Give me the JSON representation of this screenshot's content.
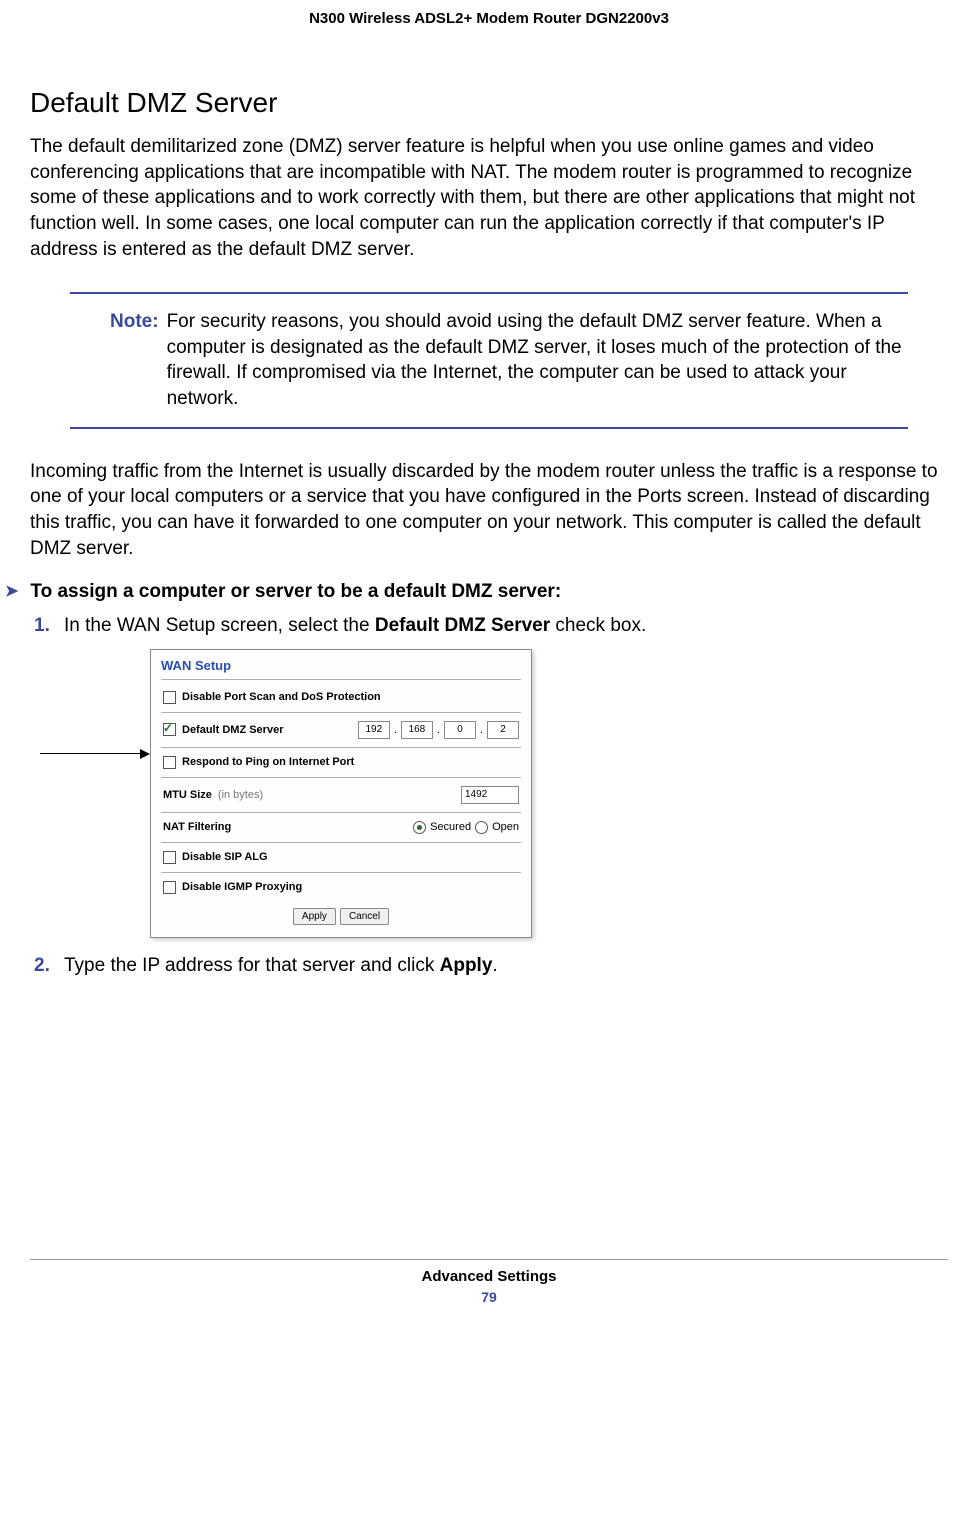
{
  "header": {
    "title": "N300 Wireless ADSL2+ Modem Router DGN2200v3"
  },
  "section": {
    "heading": "Default DMZ Server",
    "para1": "The default demilitarized zone (DMZ) server feature is helpful when you use online games and video conferencing applications that are incompatible with NAT. The modem router is programmed to recognize some of these applications and to work correctly with them, but there are other applications that might not function well. In some cases, one local computer can run the application correctly if that computer's IP address is entered as the default DMZ server.",
    "note_label": "Note:",
    "note_text": "For security reasons, you should avoid using the default DMZ server feature. When a computer is designated as the default DMZ server, it loses much of the protection of the firewall. If compromised via the Internet, the computer can be used to attack your network.",
    "para2": "Incoming traffic from the Internet is usually discarded by the modem router unless the traffic is a response to one of your local computers or a service that you have configured in the Ports screen. Instead of discarding this traffic, you can have it forwarded to one computer on your network. This computer is called the default DMZ server.",
    "procedure_heading": "To assign a computer or server to be a default DMZ server:",
    "steps": {
      "s1_num": "1.",
      "s1_pre": "In the WAN Setup screen, select the ",
      "s1_bold": "Default DMZ Server",
      "s1_post": " check box.",
      "s2_num": "2.",
      "s2_pre": "Type the IP address for that server and click ",
      "s2_bold": "Apply",
      "s2_post": "."
    }
  },
  "wan": {
    "title": "WAN Setup",
    "row1": "Disable Port Scan and DoS Protection",
    "row2_label": "Default DMZ Server",
    "row2_checked": true,
    "ip": [
      "192",
      "168",
      "0",
      "2"
    ],
    "row3": "Respond to Ping on Internet Port",
    "row4_label": "MTU Size",
    "row4_hint": "(in bytes)",
    "row4_value": "1492",
    "row5_label": "NAT Filtering",
    "row5_opt1": "Secured",
    "row5_opt2": "Open",
    "row6": "Disable SIP ALG",
    "row7": "Disable IGMP Proxying",
    "btn_apply": "Apply",
    "btn_cancel": "Cancel"
  },
  "footer": {
    "section": "Advanced Settings",
    "page": "79"
  }
}
